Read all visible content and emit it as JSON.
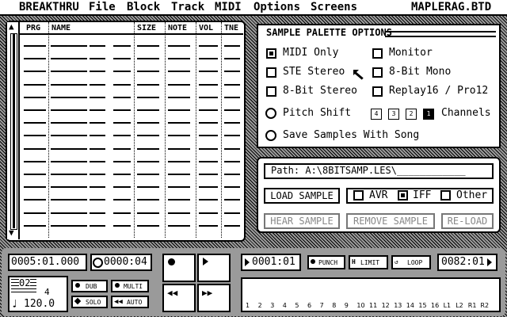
{
  "menubar": {
    "items": [
      "BREAKTHRU",
      "File",
      "Block",
      "Track",
      "MIDI",
      "Options",
      "Screens"
    ],
    "filename": "MAPLERAG.BTD"
  },
  "sample_list": {
    "columns": [
      "PRG",
      "NAME",
      "SIZE",
      "NOTE",
      "VOL",
      "TNE"
    ],
    "up_arrow": "▲",
    "down_arrow": "▼"
  },
  "palette": {
    "title": "SAMPLE PALETTE OPTIONS",
    "midi_only": {
      "label": "MIDI Only",
      "checked": true
    },
    "monitor": {
      "label": "Monitor",
      "checked": false
    },
    "ste_stereo": {
      "label": "STE Stereo",
      "checked": false
    },
    "eight_bit_mono": {
      "label": "8-Bit Mono",
      "checked": false
    },
    "eight_bit_stereo": {
      "label": "8-Bit Stereo",
      "checked": false
    },
    "replay": {
      "label": "Replay16 / Pro12",
      "checked": false
    },
    "pitch_shift": {
      "label": "Pitch Shift"
    },
    "channels": {
      "label": "Channels",
      "options": [
        "4",
        "3",
        "2",
        "1"
      ],
      "selected": "1"
    },
    "save_samples": {
      "label": "Save Samples With Song"
    }
  },
  "load": {
    "path": "Path: A:\\8BITSAMP.LES\\____________",
    "load_sample": "LOAD SAMPLE",
    "avr": {
      "label": "AVR",
      "checked": false
    },
    "iff": {
      "label": "IFF",
      "checked": true
    },
    "other": {
      "label": "Other",
      "checked": false
    },
    "hear_sample": "HEAR SAMPLE",
    "remove_sample": "REMOVE SAMPLE",
    "reload": "RE-LOAD"
  },
  "transport": {
    "position": "0005:01.000",
    "time": "0000:04",
    "loop_start": "0001:01",
    "punch": "PUNCH",
    "limit": "LIMIT",
    "loop": "LOOP",
    "loop_end": "0082:01",
    "time_sig_top": "02",
    "time_sig_bottom": "4",
    "tempo": "120.0",
    "dub": "DUB",
    "multi": "MULTI",
    "solo": "SOLO",
    "auto": "AUTO",
    "tracks": [
      "1",
      "2",
      "3",
      "4",
      "5",
      "6",
      "7",
      "8",
      "9",
      "10",
      "11",
      "12",
      "13",
      "14",
      "15",
      "16",
      "L1",
      "L2",
      "R1",
      "R2"
    ]
  }
}
